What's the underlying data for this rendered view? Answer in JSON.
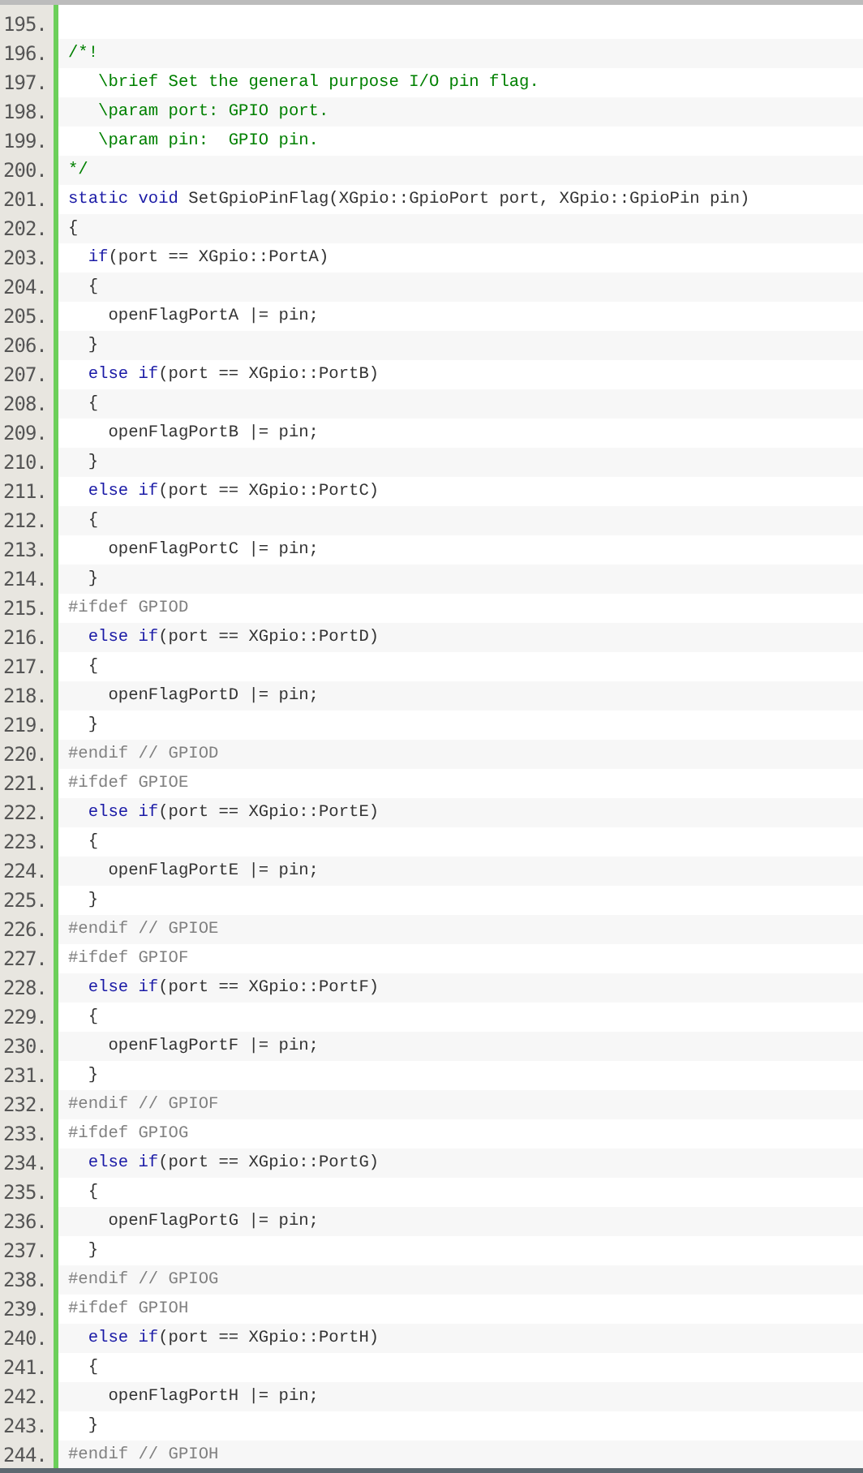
{
  "code_lines": [
    {
      "number": "195."
    },
    {
      "number": "196.",
      "tokens": [
        {
          "kind": "comment",
          "text": "/*!"
        }
      ]
    },
    {
      "number": "197.",
      "tokens": [
        {
          "kind": "comment",
          "text": "   \\brief Set the general purpose I/O pin flag."
        }
      ]
    },
    {
      "number": "198.",
      "tokens": [
        {
          "kind": "comment",
          "text": "   \\param port: GPIO port."
        }
      ]
    },
    {
      "number": "199.",
      "tokens": [
        {
          "kind": "comment",
          "text": "   \\param pin:  GPIO pin."
        }
      ]
    },
    {
      "number": "200.",
      "tokens": [
        {
          "kind": "comment",
          "text": "*/"
        }
      ]
    },
    {
      "number": "201.",
      "tokens": [
        {
          "kind": "keyword",
          "text": "static void"
        },
        {
          "kind": "text",
          "text": " SetGpioPinFlag(XGpio::GpioPort port, XGpio::GpioPin pin)"
        }
      ]
    },
    {
      "number": "202.",
      "tokens": [
        {
          "kind": "text",
          "text": "{"
        }
      ]
    },
    {
      "number": "203.",
      "tokens": [
        {
          "kind": "keyword",
          "text": "  if"
        },
        {
          "kind": "text",
          "text": "(port == XGpio::PortA)"
        }
      ]
    },
    {
      "number": "204.",
      "tokens": [
        {
          "kind": "text",
          "text": "  {"
        }
      ]
    },
    {
      "number": "205.",
      "tokens": [
        {
          "kind": "text",
          "text": "    openFlagPortA |= pin;"
        }
      ]
    },
    {
      "number": "206.",
      "tokens": [
        {
          "kind": "text",
          "text": "  }"
        }
      ]
    },
    {
      "number": "207.",
      "tokens": [
        {
          "kind": "keyword",
          "text": "  else if"
        },
        {
          "kind": "text",
          "text": "(port == XGpio::PortB)"
        }
      ]
    },
    {
      "number": "208.",
      "tokens": [
        {
          "kind": "text",
          "text": "  {"
        }
      ]
    },
    {
      "number": "209.",
      "tokens": [
        {
          "kind": "text",
          "text": "    openFlagPortB |= pin;"
        }
      ]
    },
    {
      "number": "210.",
      "tokens": [
        {
          "kind": "text",
          "text": "  }"
        }
      ]
    },
    {
      "number": "211.",
      "tokens": [
        {
          "kind": "keyword",
          "text": "  else if"
        },
        {
          "kind": "text",
          "text": "(port == XGpio::PortC)"
        }
      ]
    },
    {
      "number": "212.",
      "tokens": [
        {
          "kind": "text",
          "text": "  {"
        }
      ]
    },
    {
      "number": "213.",
      "tokens": [
        {
          "kind": "text",
          "text": "    openFlagPortC |= pin;"
        }
      ]
    },
    {
      "number": "214.",
      "tokens": [
        {
          "kind": "text",
          "text": "  }"
        }
      ]
    },
    {
      "number": "215.",
      "tokens": [
        {
          "kind": "preproc",
          "text": "#ifdef GPIOD"
        }
      ]
    },
    {
      "number": "216.",
      "tokens": [
        {
          "kind": "keyword",
          "text": "  else if"
        },
        {
          "kind": "text",
          "text": "(port == XGpio::PortD)"
        }
      ]
    },
    {
      "number": "217.",
      "tokens": [
        {
          "kind": "text",
          "text": "  {"
        }
      ]
    },
    {
      "number": "218.",
      "tokens": [
        {
          "kind": "text",
          "text": "    openFlagPortD |= pin;"
        }
      ]
    },
    {
      "number": "219.",
      "tokens": [
        {
          "kind": "text",
          "text": "  }"
        }
      ]
    },
    {
      "number": "220.",
      "tokens": [
        {
          "kind": "preproc",
          "text": "#endif // GPIOD"
        }
      ]
    },
    {
      "number": "221.",
      "tokens": [
        {
          "kind": "preproc",
          "text": "#ifdef GPIOE"
        }
      ]
    },
    {
      "number": "222.",
      "tokens": [
        {
          "kind": "keyword",
          "text": "  else if"
        },
        {
          "kind": "text",
          "text": "(port == XGpio::PortE)"
        }
      ]
    },
    {
      "number": "223.",
      "tokens": [
        {
          "kind": "text",
          "text": "  {"
        }
      ]
    },
    {
      "number": "224.",
      "tokens": [
        {
          "kind": "text",
          "text": "    openFlagPortE |= pin;"
        }
      ]
    },
    {
      "number": "225.",
      "tokens": [
        {
          "kind": "text",
          "text": "  }"
        }
      ]
    },
    {
      "number": "226.",
      "tokens": [
        {
          "kind": "preproc",
          "text": "#endif // GPIOE"
        }
      ]
    },
    {
      "number": "227.",
      "tokens": [
        {
          "kind": "preproc",
          "text": "#ifdef GPIOF"
        }
      ]
    },
    {
      "number": "228.",
      "tokens": [
        {
          "kind": "keyword",
          "text": "  else if"
        },
        {
          "kind": "text",
          "text": "(port == XGpio::PortF)"
        }
      ]
    },
    {
      "number": "229.",
      "tokens": [
        {
          "kind": "text",
          "text": "  {"
        }
      ]
    },
    {
      "number": "230.",
      "tokens": [
        {
          "kind": "text",
          "text": "    openFlagPortF |= pin;"
        }
      ]
    },
    {
      "number": "231.",
      "tokens": [
        {
          "kind": "text",
          "text": "  }"
        }
      ]
    },
    {
      "number": "232.",
      "tokens": [
        {
          "kind": "preproc",
          "text": "#endif // GPIOF"
        }
      ]
    },
    {
      "number": "233.",
      "tokens": [
        {
          "kind": "preproc",
          "text": "#ifdef GPIOG"
        }
      ]
    },
    {
      "number": "234.",
      "tokens": [
        {
          "kind": "keyword",
          "text": "  else if"
        },
        {
          "kind": "text",
          "text": "(port == XGpio::PortG)"
        }
      ]
    },
    {
      "number": "235.",
      "tokens": [
        {
          "kind": "text",
          "text": "  {"
        }
      ]
    },
    {
      "number": "236.",
      "tokens": [
        {
          "kind": "text",
          "text": "    openFlagPortG |= pin;"
        }
      ]
    },
    {
      "number": "237.",
      "tokens": [
        {
          "kind": "text",
          "text": "  }"
        }
      ]
    },
    {
      "number": "238.",
      "tokens": [
        {
          "kind": "preproc",
          "text": "#endif // GPIOG"
        }
      ]
    },
    {
      "number": "239.",
      "tokens": [
        {
          "kind": "preproc",
          "text": "#ifdef GPIOH"
        }
      ]
    },
    {
      "number": "240.",
      "tokens": [
        {
          "kind": "keyword",
          "text": "  else if"
        },
        {
          "kind": "text",
          "text": "(port == XGpio::PortH)"
        }
      ]
    },
    {
      "number": "241.",
      "tokens": [
        {
          "kind": "text",
          "text": "  {"
        }
      ]
    },
    {
      "number": "242.",
      "tokens": [
        {
          "kind": "text",
          "text": "    openFlagPortH |= pin;"
        }
      ]
    },
    {
      "number": "243.",
      "tokens": [
        {
          "kind": "text",
          "text": "  }"
        }
      ]
    },
    {
      "number": "244.",
      "tokens": [
        {
          "kind": "preproc",
          "text": "#endif // GPIOH"
        }
      ]
    }
  ]
}
